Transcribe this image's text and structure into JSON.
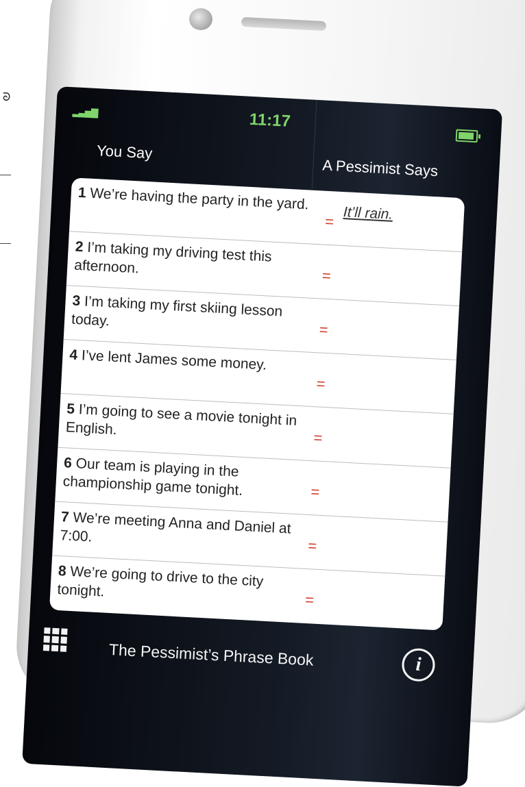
{
  "margin_glyph": "ᘐ",
  "status": {
    "signal": "▂▃▅▇",
    "time": "11:17"
  },
  "header": {
    "left": "You Say",
    "right": "A Pessimist Says"
  },
  "rows": [
    {
      "number": "1",
      "text": "We’re having the party in the yard.",
      "equals": "=",
      "answer": "It’ll rain."
    },
    {
      "number": "2",
      "text": "I’m taking my driving test this afternoon.",
      "equals": "=",
      "answer": ""
    },
    {
      "number": "3",
      "text": "I’m taking my first skiing lesson today.",
      "equals": "=",
      "answer": ""
    },
    {
      "number": "4",
      "text": "I’ve lent James some money.",
      "equals": "=",
      "answer": ""
    },
    {
      "number": "5",
      "text": "I’m going to see a movie tonight in English.",
      "equals": "=",
      "answer": ""
    },
    {
      "number": "6",
      "text": "Our team is playing in the championship game tonight.",
      "equals": "=",
      "answer": ""
    },
    {
      "number": "7",
      "text": "We’re meeting Anna and Daniel at 7:00.",
      "equals": "=",
      "answer": ""
    },
    {
      "number": "8",
      "text": "We’re going to drive to the city tonight.",
      "equals": "=",
      "answer": ""
    }
  ],
  "footer": {
    "title": "The Pessimist’s Phrase Book",
    "info_glyph": "i"
  },
  "colors": {
    "status_green": "#7fd46a",
    "equals_red": "#d23a2a",
    "screen_dark": "#0b0f16"
  },
  "icons": [
    "signal-icon",
    "battery-icon",
    "grid-menu-icon",
    "info-icon"
  ]
}
